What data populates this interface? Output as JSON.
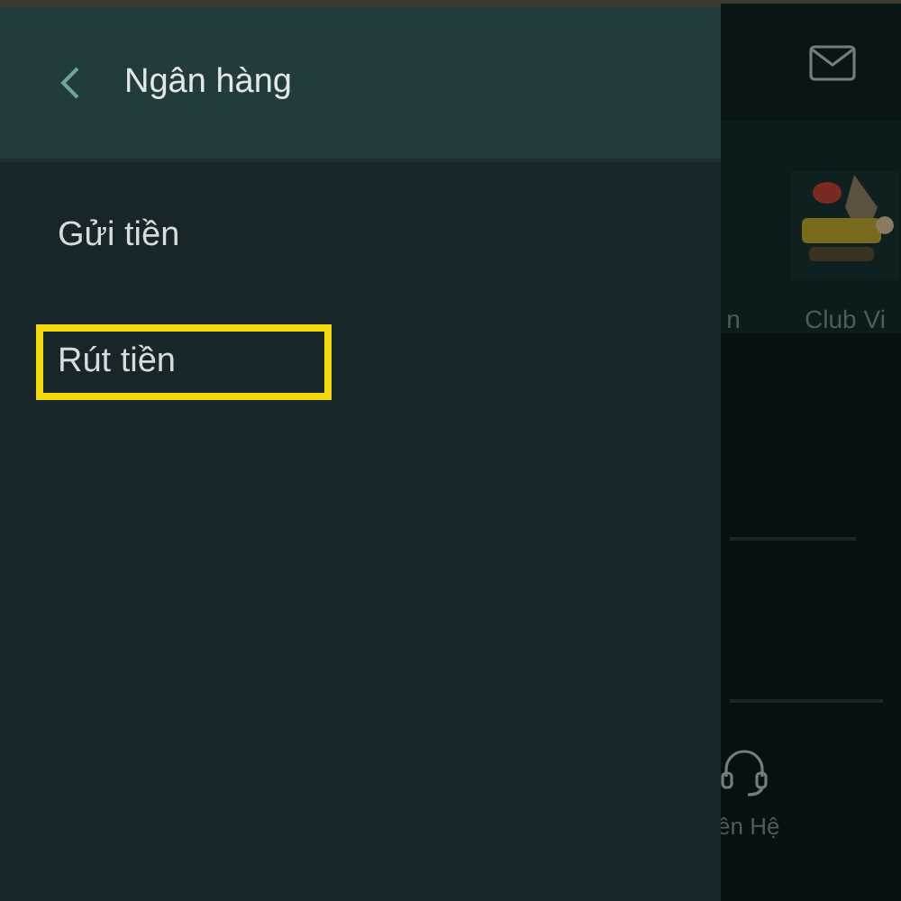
{
  "drawer": {
    "title": "Ngân hàng",
    "items": [
      {
        "label": "Gửi tiền",
        "highlighted": false
      },
      {
        "label": "Rút tiền",
        "highlighted": true
      }
    ]
  },
  "background": {
    "games": [
      {
        "label": "n"
      },
      {
        "label": "Club Vi",
        "kind": "picture"
      }
    ],
    "contact_label": "ên Hệ"
  }
}
